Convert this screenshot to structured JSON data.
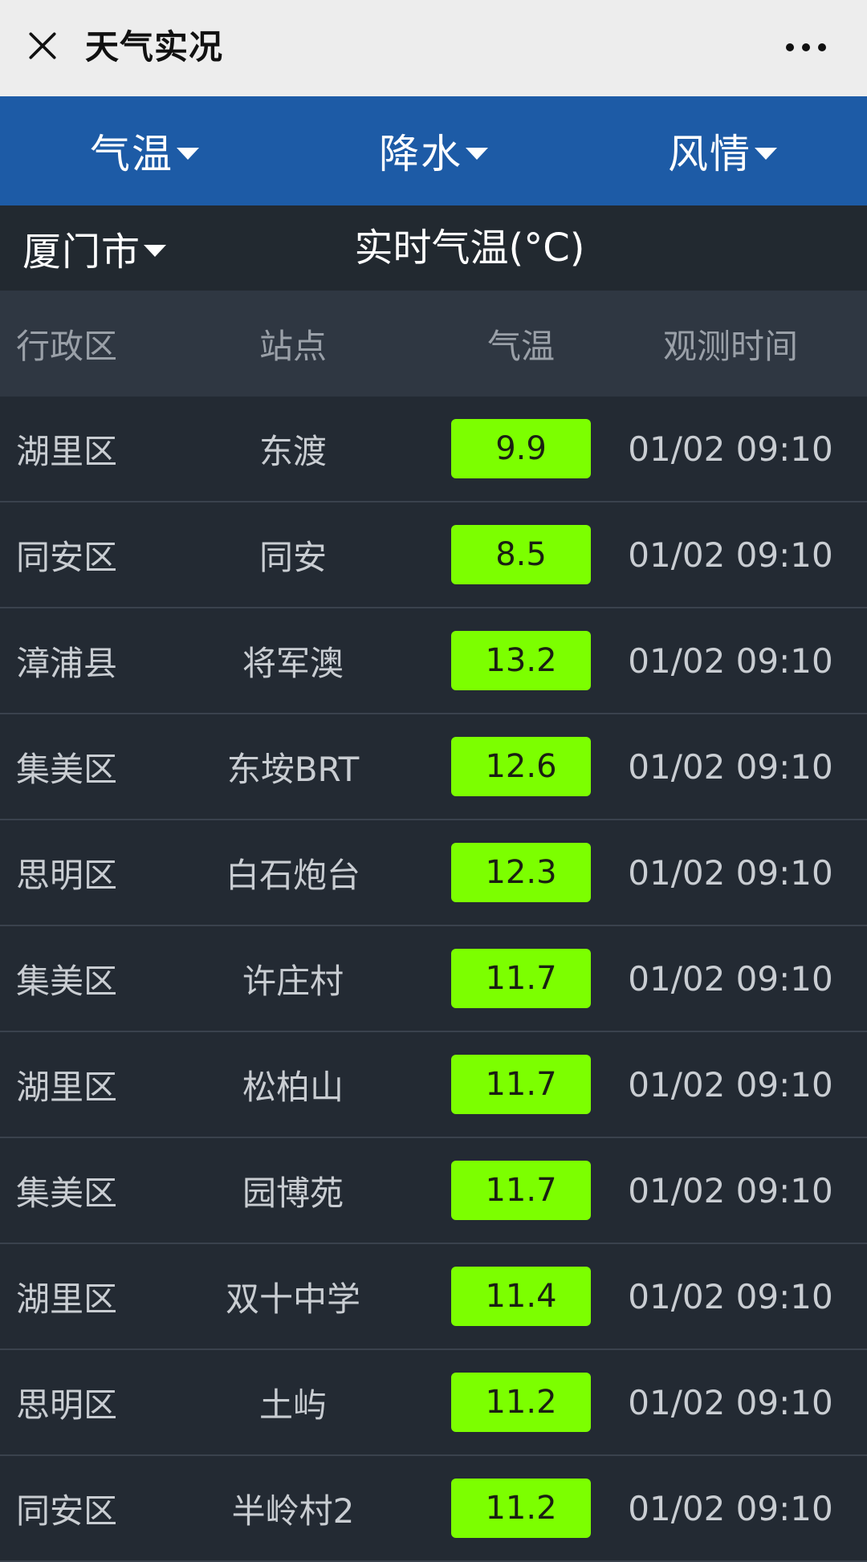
{
  "titlebar": {
    "title": "天气实况",
    "close_icon": "close-icon",
    "more_icon": "more-dots-icon"
  },
  "tabs": [
    {
      "label": "气温"
    },
    {
      "label": "降水"
    },
    {
      "label": "风情"
    }
  ],
  "subbar": {
    "city": "厦门市",
    "title": "实时气温(°C)"
  },
  "table": {
    "headers": [
      "行政区",
      "站点",
      "气温",
      "观测时间"
    ],
    "rows": [
      {
        "district": "湖里区",
        "station": "东渡",
        "temp": "9.9",
        "time": "01/02 09:10"
      },
      {
        "district": "同安区",
        "station": "同安",
        "temp": "8.5",
        "time": "01/02 09:10"
      },
      {
        "district": "漳浦县",
        "station": "将军澳",
        "temp": "13.2",
        "time": "01/02 09:10"
      },
      {
        "district": "集美区",
        "station": "东垵BRT",
        "temp": "12.6",
        "time": "01/02 09:10"
      },
      {
        "district": "思明区",
        "station": "白石炮台",
        "temp": "12.3",
        "time": "01/02 09:10"
      },
      {
        "district": "集美区",
        "station": "许庄村",
        "temp": "11.7",
        "time": "01/02 09:10"
      },
      {
        "district": "湖里区",
        "station": "松柏山",
        "temp": "11.7",
        "time": "01/02 09:10"
      },
      {
        "district": "集美区",
        "station": "园博苑",
        "temp": "11.7",
        "time": "01/02 09:10"
      },
      {
        "district": "湖里区",
        "station": "双十中学",
        "temp": "11.4",
        "time": "01/02 09:10"
      },
      {
        "district": "思明区",
        "station": "土屿",
        "temp": "11.2",
        "time": "01/02 09:10"
      },
      {
        "district": "同安区",
        "station": "半岭村2",
        "temp": "11.2",
        "time": "01/02 09:10"
      }
    ]
  },
  "colors": {
    "titlebar_bg": "#ededed",
    "tabs_bg": "#1d5ba6",
    "page_bg": "#232a33",
    "header_bg": "#2f3742",
    "temp_badge": "#7cff00"
  }
}
